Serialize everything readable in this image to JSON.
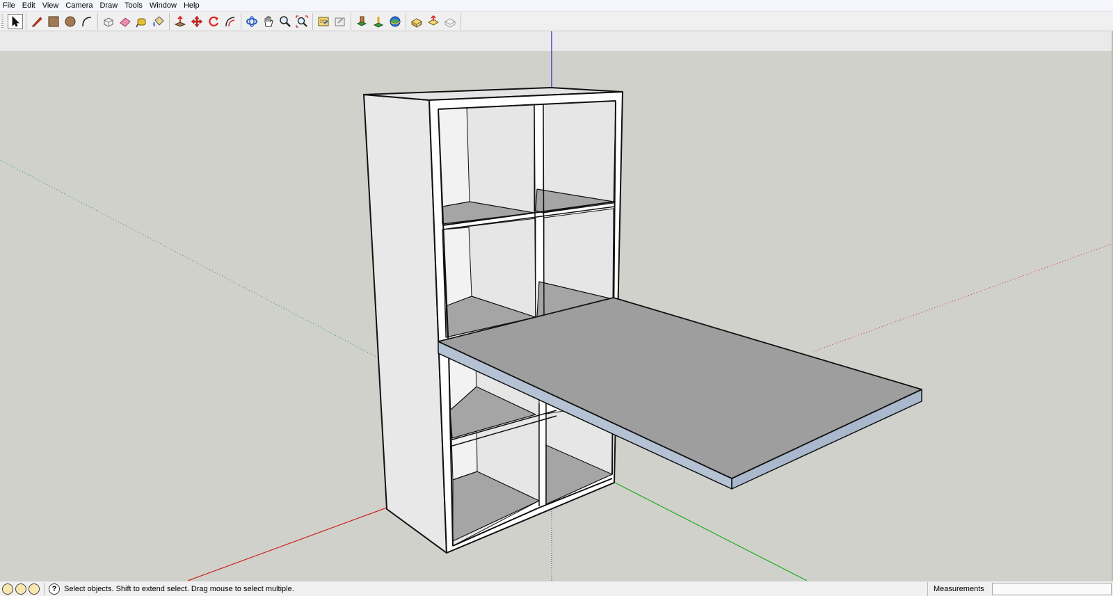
{
  "menu": {
    "items": [
      "File",
      "Edit",
      "View",
      "Camera",
      "Draw",
      "Tools",
      "Window",
      "Help"
    ]
  },
  "toolbar": {
    "groups": [
      [
        "select-icon"
      ],
      [
        "pencil-icon",
        "rectangle-icon",
        "circle-icon",
        "arc-icon"
      ],
      [
        "make-component-icon",
        "eraser-icon",
        "tape-measure-icon",
        "paint-bucket-icon"
      ],
      [
        "push-pull-icon",
        "move-icon",
        "rotate-icon",
        "offset-icon"
      ],
      [
        "orbit-icon",
        "pan-icon",
        "zoom-icon",
        "zoom-extents-icon"
      ],
      [
        "get-models-icon",
        "share-model-icon"
      ],
      [
        "add-location-icon",
        "toggle-terrain-icon",
        "google-earth-icon"
      ],
      [
        "get-models-3d-icon",
        "share-component-icon",
        "3d-warehouse-icon"
      ]
    ],
    "active_tool": "select-icon"
  },
  "status": {
    "icons": [
      "geo-location-icon",
      "credits-icon",
      "user-icon"
    ],
    "help_icon_label": "?",
    "message": "Select objects. Shift to extend select. Drag mouse to select multiple.",
    "measurements_label": "Measurements",
    "measurements_value": ""
  },
  "colors": {
    "background": "#d1d1cc",
    "sky": "#eaeaea",
    "red_axis": "#cc2222",
    "green_axis": "#22aa22",
    "blue_axis": "#2222cc",
    "face_front": "#ffffff",
    "face_side": "#e8e8e8",
    "face_back": "#e6e6e6",
    "face_shelf": "#a5a5a5",
    "table_top": "#9e9e9e",
    "table_edge": "#b4c2d4"
  }
}
